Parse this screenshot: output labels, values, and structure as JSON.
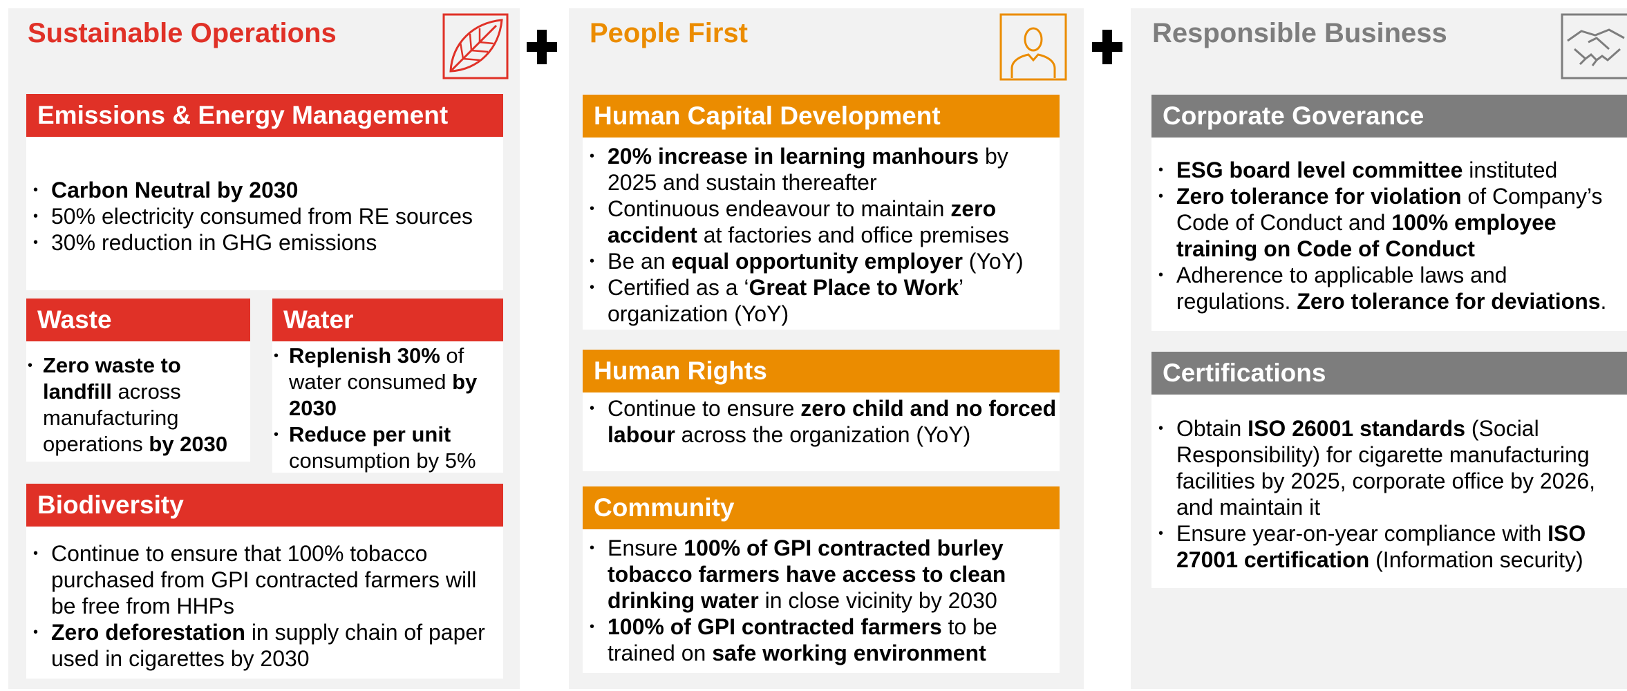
{
  "colors": {
    "red": "#e03127",
    "orange": "#eb8c00",
    "grey": "#7d7d7d",
    "panel": "#f2f2f2"
  },
  "columns": [
    {
      "title": "Sustainable Operations",
      "icon": "leaf-icon",
      "sections": [
        {
          "heading": "Emissions & Energy Management",
          "bullets": [
            [
              {
                "t": "Carbon Neutral by 2030",
                "b": true
              }
            ],
            [
              {
                "t": "50% electricity consumed from RE sources",
                "b": false
              }
            ],
            [
              {
                "t": "30% reduction in GHG emissions",
                "b": false
              }
            ]
          ]
        },
        {
          "heading": "Waste",
          "bullets": [
            [
              {
                "t": "Zero waste to landfill",
                "b": true
              },
              {
                "t": " across manufacturing operations ",
                "b": false
              },
              {
                "t": "by 2030",
                "b": true
              }
            ]
          ]
        },
        {
          "heading": "Water",
          "bullets": [
            [
              {
                "t": "Replenish 30%",
                "b": true
              },
              {
                "t": " of water consumed ",
                "b": false
              },
              {
                "t": "by 2030",
                "b": true
              }
            ],
            [
              {
                "t": "Reduce per unit",
                "b": true
              },
              {
                "t": " consumption by 5%",
                "b": false
              }
            ]
          ]
        },
        {
          "heading": "Biodiversity",
          "bullets": [
            [
              {
                "t": "Continue to ensure that 100% tobacco purchased from GPI contracted farmers will be free from HHPs",
                "b": false
              }
            ],
            [
              {
                "t": "Zero deforestation",
                "b": true
              },
              {
                "t": " in supply chain of paper used in cigarettes by 2030",
                "b": false
              }
            ]
          ]
        }
      ]
    },
    {
      "title": "People First",
      "icon": "person-icon",
      "sections": [
        {
          "heading": "Human Capital Development",
          "bullets": [
            [
              {
                "t": "20% increase in learning manhours",
                "b": true
              },
              {
                "t": " by 2025 and sustain thereafter",
                "b": false
              }
            ],
            [
              {
                "t": "Continuous endeavour to maintain ",
                "b": false
              },
              {
                "t": "zero accident",
                "b": true
              },
              {
                "t": " at factories and office premises",
                "b": false
              }
            ],
            [
              {
                "t": "Be an ",
                "b": false
              },
              {
                "t": "equal opportunity employer",
                "b": true
              },
              {
                "t": " (YoY)",
                "b": false
              }
            ],
            [
              {
                "t": "Certified as a ‘",
                "b": false
              },
              {
                "t": "Great Place to Work",
                "b": true
              },
              {
                "t": "’ organization (YoY)",
                "b": false
              }
            ]
          ]
        },
        {
          "heading": "Human Rights",
          "bullets": [
            [
              {
                "t": "Continue to ensure ",
                "b": false
              },
              {
                "t": "zero child and no forced labour",
                "b": true
              },
              {
                "t": " across the organization (YoY)",
                "b": false
              }
            ]
          ]
        },
        {
          "heading": "Community",
          "bullets": [
            [
              {
                "t": "Ensure ",
                "b": false
              },
              {
                "t": "100% of GPI contracted burley tobacco farmers have access to clean drinking water",
                "b": true
              },
              {
                "t": " in close vicinity by 2030",
                "b": false
              }
            ],
            [
              {
                "t": "100% of GPI contracted farmers",
                "b": true
              },
              {
                "t": " to be trained on ",
                "b": false
              },
              {
                "t": "safe working environment",
                "b": true
              }
            ]
          ]
        }
      ]
    },
    {
      "title": "Responsible Business",
      "icon": "handshake-icon",
      "sections": [
        {
          "heading": "Corporate Goverance",
          "bullets": [
            [
              {
                "t": "ESG board level committee",
                "b": true
              },
              {
                "t": " instituted",
                "b": false
              }
            ],
            [
              {
                "t": "Zero tolerance for violation",
                "b": true
              },
              {
                "t": " of Company’s Code of Conduct and ",
                "b": false
              },
              {
                "t": "100% employee training on Code of Conduct",
                "b": true
              }
            ],
            [
              {
                "t": "Adherence to applicable laws and regulations. ",
                "b": false
              },
              {
                "t": "Zero tolerance for deviations",
                "b": true
              },
              {
                "t": ".",
                "b": false
              }
            ]
          ]
        },
        {
          "heading": "Certifications",
          "bullets": [
            [
              {
                "t": "Obtain ",
                "b": false
              },
              {
                "t": "ISO 26001 standards",
                "b": true
              },
              {
                "t": " (Social Responsibility) for cigarette manufacturing facilities by 2025, corporate office by 2026, and maintain it",
                "b": false
              }
            ],
            [
              {
                "t": "Ensure year-on-year compliance with ",
                "b": false
              },
              {
                "t": "ISO 27001 certification",
                "b": true
              },
              {
                "t": " (Information security)",
                "b": false
              }
            ]
          ]
        }
      ]
    }
  ]
}
